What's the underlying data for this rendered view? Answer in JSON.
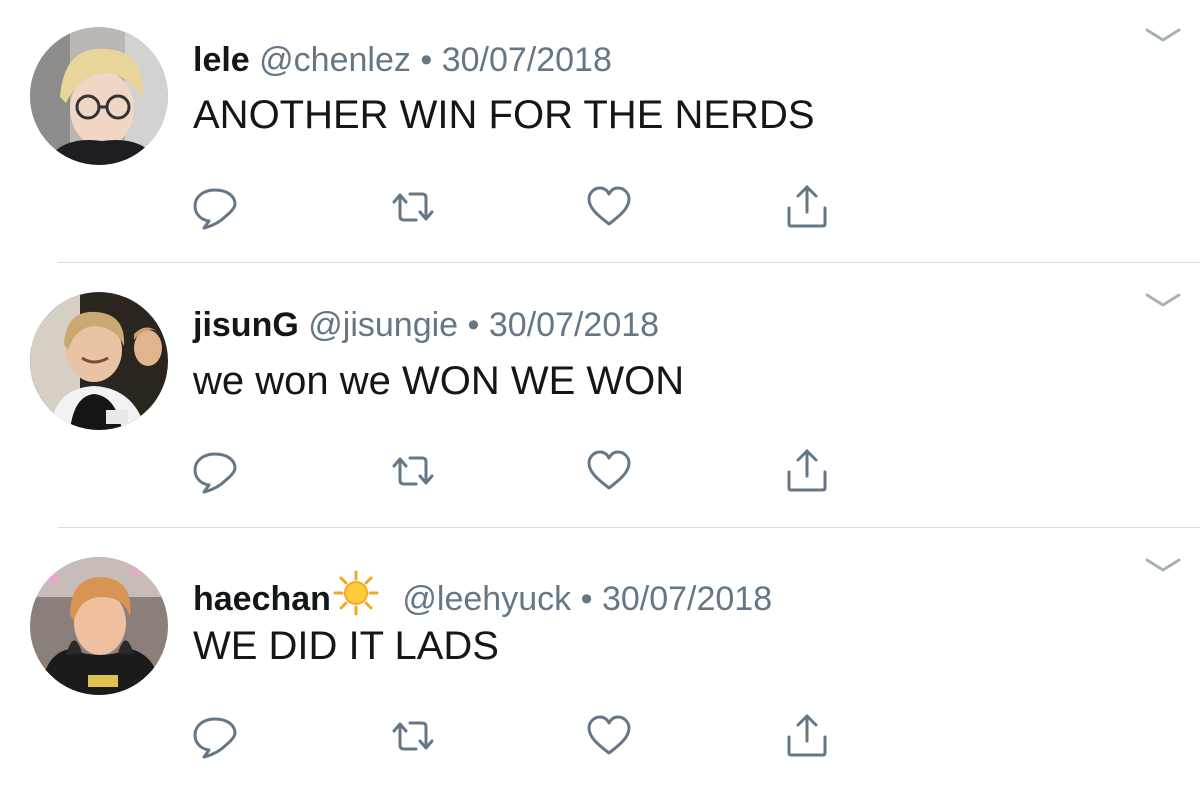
{
  "tweets": [
    {
      "name": "lele",
      "handle": "@chenlez",
      "separator": "•",
      "date": "30/07/2018",
      "text": "ANOTHER WIN FOR THE NERDS",
      "has_sun_emoji": false
    },
    {
      "name": "jisunG",
      "handle": "@jisungie",
      "separator": "•",
      "date": "30/07/2018",
      "text": "we won we WON WE WON",
      "has_sun_emoji": false
    },
    {
      "name": "haechan",
      "handle": "@leehyuck",
      "separator": "•",
      "date": "30/07/2018",
      "text": "WE DID IT LADS",
      "has_sun_emoji": true
    }
  ],
  "actions": [
    "reply-icon",
    "retweet-icon",
    "like-icon",
    "share-icon"
  ],
  "colors": {
    "name": "#14171a",
    "meta": "#657786",
    "icon": "#657786",
    "divider": "#d6dadd",
    "background": "#ffffff"
  }
}
